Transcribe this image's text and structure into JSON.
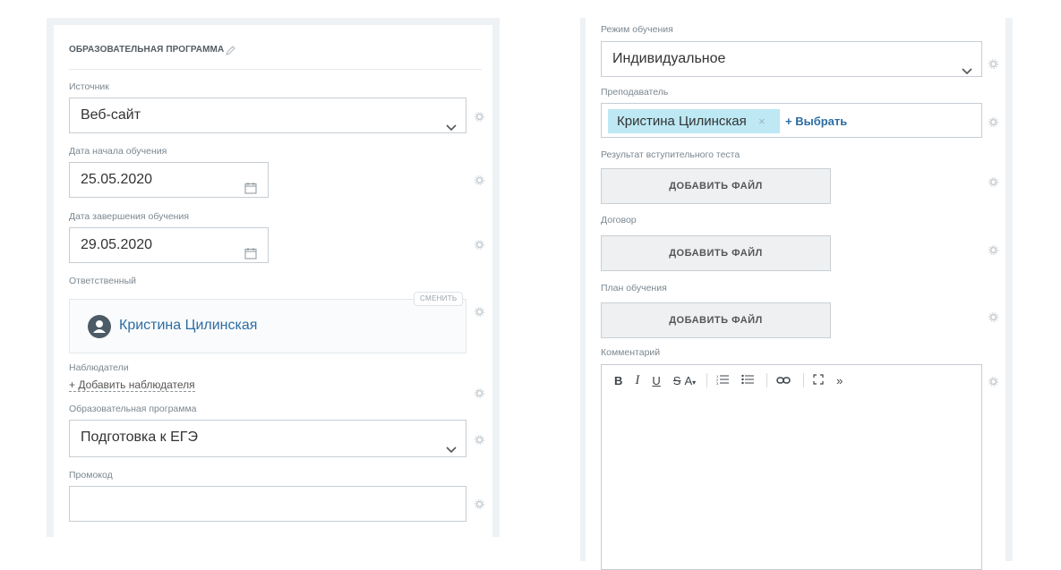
{
  "left": {
    "section_title": "ОБРАЗОВАТЕЛЬНАЯ ПРОГРАММА",
    "source": {
      "label": "Источник",
      "value": "Веб-сайт"
    },
    "start_date": {
      "label": "Дата начала обучения",
      "value": "25.05.2020"
    },
    "end_date": {
      "label": "Дата завершения обучения",
      "value": "29.05.2020"
    },
    "responsible": {
      "label": "Ответственный",
      "change": "СМЕНИТЬ",
      "name": "Кристина Цилинская"
    },
    "observers": {
      "label": "Наблюдатели",
      "add": "+ Добавить наблюдателя"
    },
    "program": {
      "label": "Образовательная программа",
      "value": "Подготовка к ЕГЭ"
    },
    "promo": {
      "label": "Промокод",
      "value": ""
    }
  },
  "right": {
    "mode": {
      "label": "Режим обучения",
      "value": "Индивидуальное"
    },
    "teacher": {
      "label": "Преподаватель",
      "tag": "Кристина Цилинская",
      "remove": "×",
      "pick": "+ Выбрать"
    },
    "entrance_test": {
      "label": "Результат вступительного теста",
      "button": "ДОБАВИТЬ ФАЙЛ"
    },
    "contract": {
      "label": "Договор",
      "button": "ДОБАВИТЬ ФАЙЛ"
    },
    "plan": {
      "label": "План обучения",
      "button": "ДОБАВИТЬ ФАЙЛ"
    },
    "comment": {
      "label": "Комментарий",
      "toolbar": {
        "bold": "B",
        "italic": "I",
        "underline": "U",
        "strike": "S",
        "fontsize": "A",
        "more": "»"
      }
    }
  },
  "icons": [
    "pencil-icon",
    "chevron-down-icon",
    "calendar-icon",
    "gear-icon",
    "user-icon",
    "link-icon",
    "fullscreen-icon",
    "ordered-list-icon",
    "unordered-list-icon"
  ],
  "colors": {
    "link": "#2d6da3",
    "tag_bg": "#bde8f4",
    "panel_bg": "#eef2f4"
  }
}
